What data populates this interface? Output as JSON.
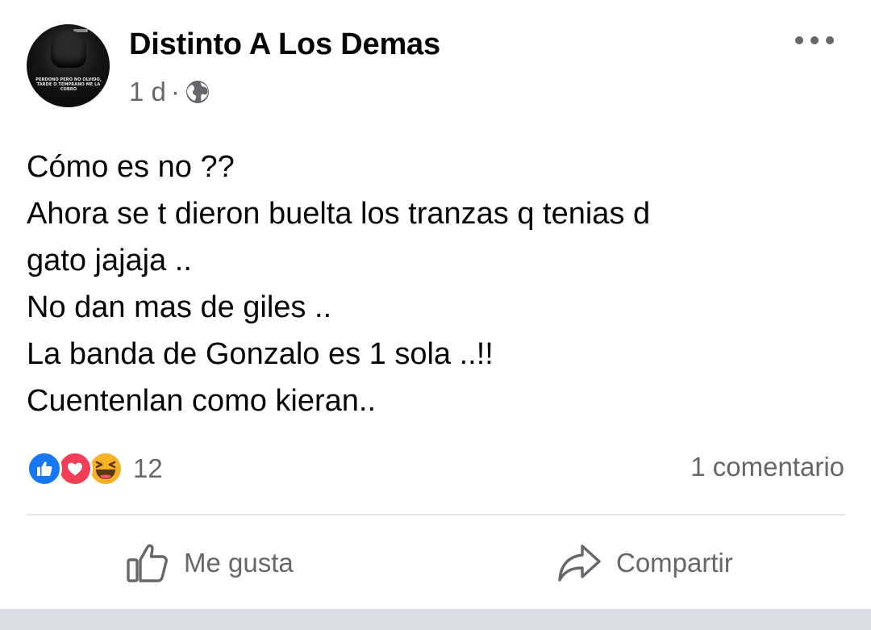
{
  "post": {
    "author": "Distinto A Los Demas",
    "time": "1 d",
    "separator": "·",
    "privacy_icon": "globe-icon",
    "avatar_caption": "PERDONO PERO NO OLVIDO, TARDE O TEMPRANO ME LA COBRO",
    "more_icon": "more-options-icon",
    "lines": [
      "Cómo es no ??",
      "Ahora se t dieron buelta los tranzas q tenias d",
      "gato jajaja ..",
      "No dan mas de giles ..",
      "La banda de Gonzalo es 1 sola ..!!",
      "Cuentenlan como kieran.."
    ]
  },
  "engagement": {
    "reaction_icons": [
      "like-reaction-icon",
      "love-reaction-icon",
      "haha-reaction-icon"
    ],
    "reaction_count": "12",
    "comment_count": "1 comentario"
  },
  "actions": {
    "like_label": "Me gusta",
    "share_label": "Compartir"
  },
  "colors": {
    "text_primary": "#050505",
    "text_secondary": "#65676b",
    "like_blue": "#1877f2",
    "love_red": "#f33e58",
    "haha_yellow": "#f7b125",
    "divider": "#e4e6eb"
  }
}
